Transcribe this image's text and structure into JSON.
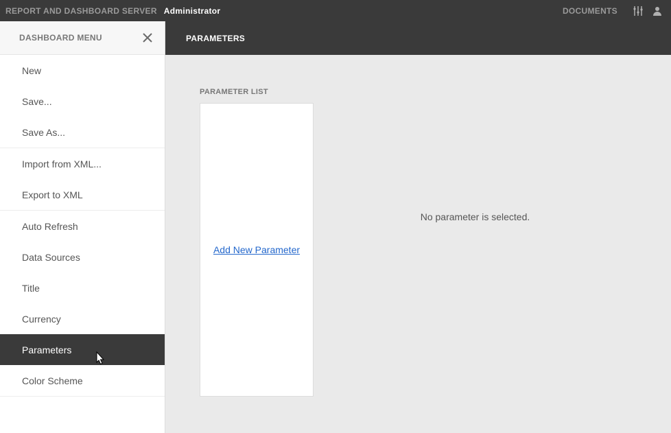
{
  "topbar": {
    "app_title": "REPORT AND DASHBOARD SERVER",
    "user_label": "Administrator",
    "nav_documents": "DOCUMENTS"
  },
  "sidebar": {
    "title": "DASHBOARD MENU",
    "groups": [
      {
        "items": [
          {
            "label": "New"
          },
          {
            "label": "Save..."
          },
          {
            "label": "Save As..."
          }
        ]
      },
      {
        "items": [
          {
            "label": "Import from XML..."
          },
          {
            "label": "Export to XML"
          }
        ]
      },
      {
        "items": [
          {
            "label": "Auto Refresh"
          },
          {
            "label": "Data Sources"
          },
          {
            "label": "Title"
          },
          {
            "label": "Currency"
          },
          {
            "label": "Parameters",
            "selected": true
          },
          {
            "label": "Color Scheme"
          }
        ]
      }
    ]
  },
  "main": {
    "header_title": "PARAMETERS",
    "param_list_label": "PARAMETER LIST",
    "add_link": "Add New Parameter",
    "placeholder": "No parameter is selected."
  }
}
